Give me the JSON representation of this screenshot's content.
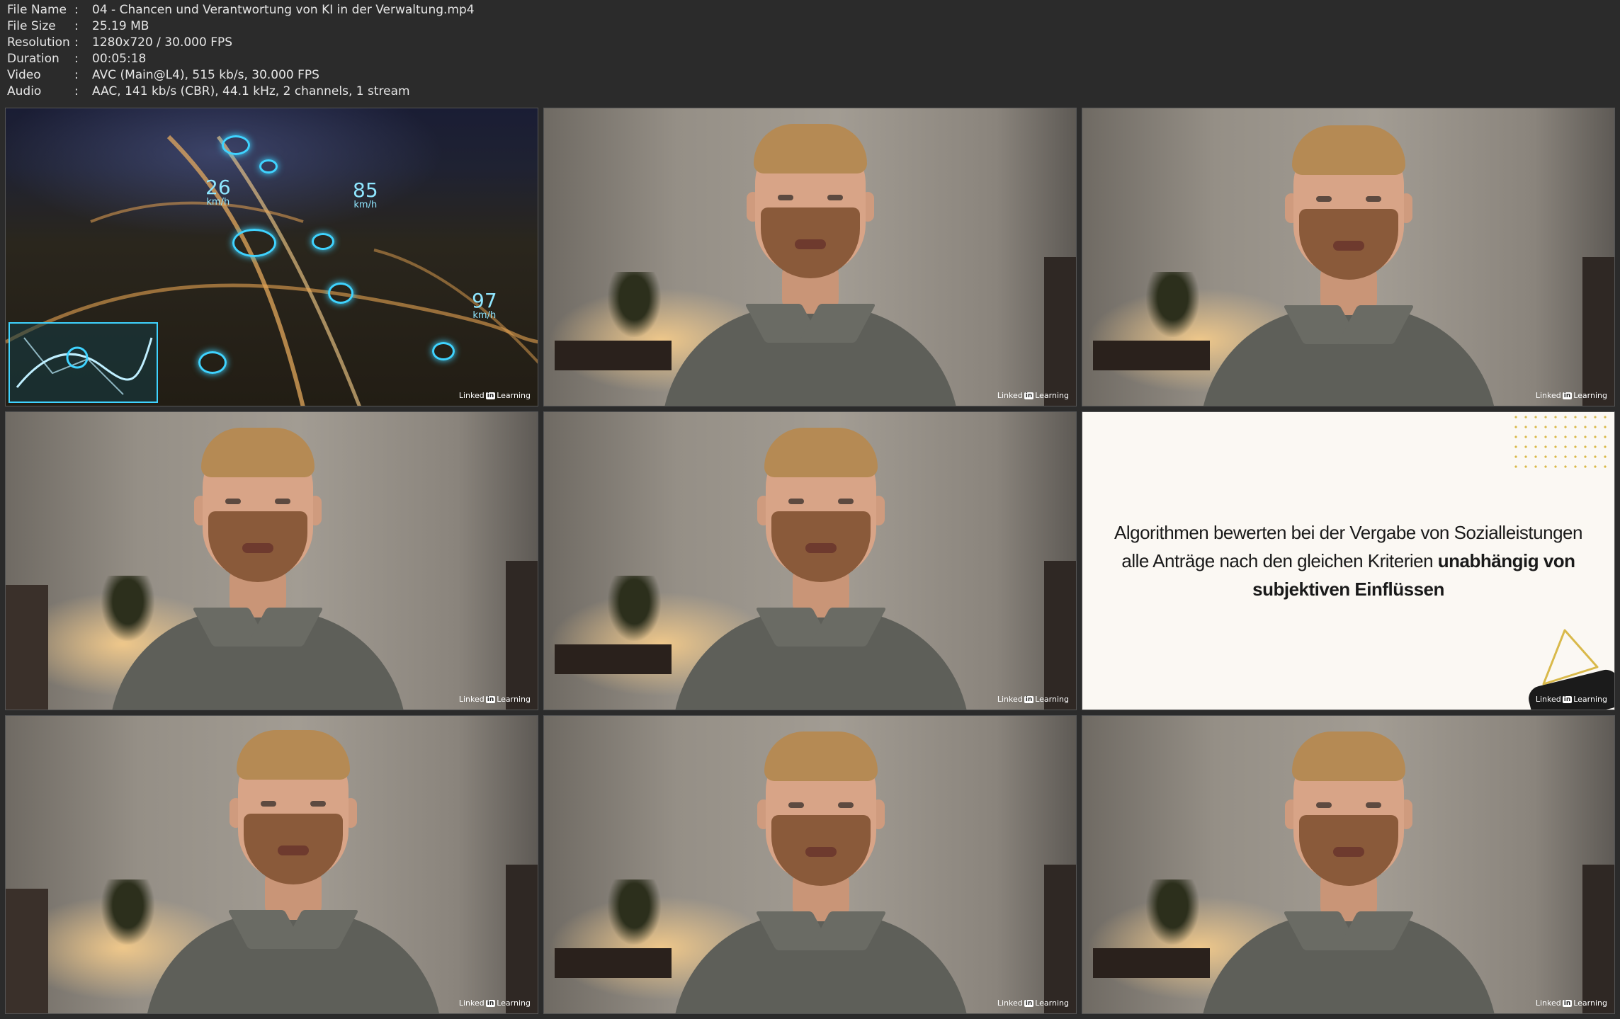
{
  "meta": {
    "rows": [
      {
        "key": "File Name",
        "value": "04 - Chancen und Verantwortung von KI in der Verwaltung.mp4"
      },
      {
        "key": "File Size",
        "value": "25.19 MB"
      },
      {
        "key": "Resolution",
        "value": "1280x720 / 30.000 FPS"
      },
      {
        "key": "Duration",
        "value": "00:05:18"
      },
      {
        "key": "Video",
        "value": "AVC (Main@L4), 515 kb/s, 30.000 FPS"
      },
      {
        "key": "Audio",
        "value": "AAC, 141 kb/s (CBR), 44.1 kHz, 2 channels, 1 stream"
      }
    ],
    "separator": ":"
  },
  "watermark": {
    "linked": "Linked",
    "in": "in",
    "learning": "Learning"
  },
  "traffic": {
    "speeds": [
      {
        "value": "26",
        "unit": "km/h"
      },
      {
        "value": "85",
        "unit": "km/h"
      },
      {
        "value": "97",
        "unit": "km/h"
      }
    ]
  },
  "slide": {
    "line1": "Algorithmen bewerten bei der Vergabe von Sozialleistungen",
    "line2_plain": "alle Anträge nach den gleichen Kriterien ",
    "line2_bold": "unabhängig von",
    "line3_bold": "subjektiven Einflüssen"
  },
  "colors": {
    "background": "#2b2b2b",
    "hud": "#3fd3ff",
    "slide_bg": "#fbf8f3",
    "accent_yellow": "#d9b94a"
  }
}
